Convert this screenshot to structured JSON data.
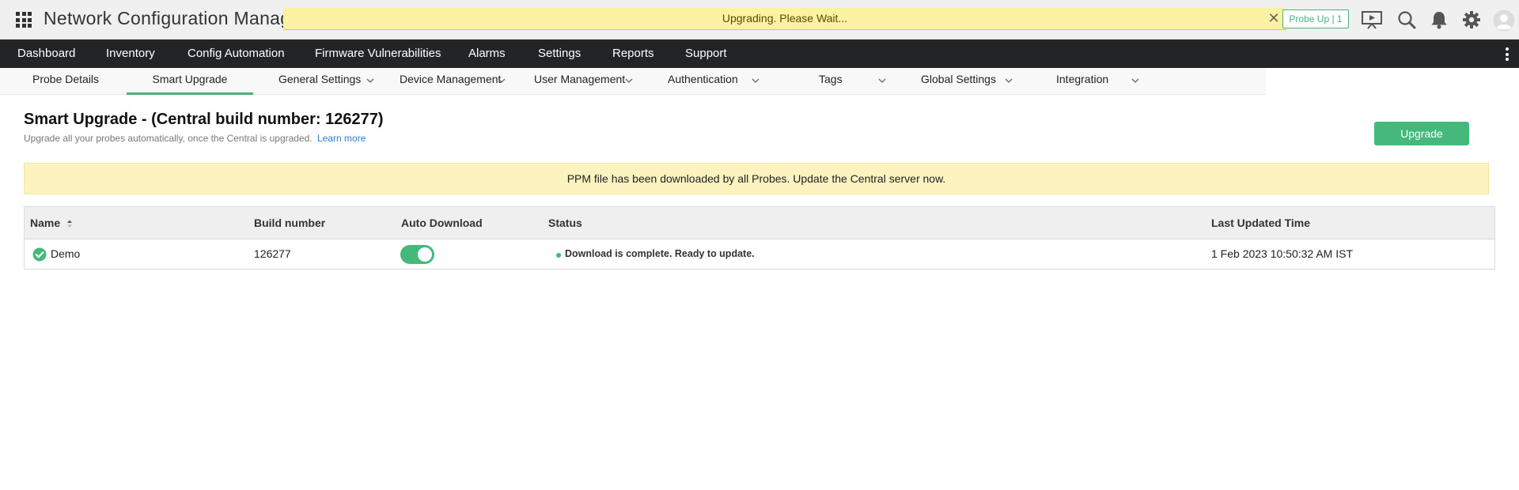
{
  "header": {
    "app_title": "Network Configuration Manager",
    "banner_text": "Upgrading. Please Wait...",
    "probe_badge": "Probe Up | 1"
  },
  "main_nav": [
    {
      "label": "Dashboard"
    },
    {
      "label": "Inventory"
    },
    {
      "label": "Config Automation"
    },
    {
      "label": "Firmware Vulnerabilities"
    },
    {
      "label": "Alarms"
    },
    {
      "label": "Settings"
    },
    {
      "label": "Reports"
    },
    {
      "label": "Support"
    }
  ],
  "sub_nav": [
    {
      "label": "Probe Details"
    },
    {
      "label": "Smart Upgrade",
      "active": true
    },
    {
      "label": "General Settings"
    },
    {
      "label": "Device Management"
    },
    {
      "label": "User Management"
    },
    {
      "label": "Authentication"
    },
    {
      "label": "Tags"
    },
    {
      "label": "Global Settings"
    },
    {
      "label": "Integration"
    }
  ],
  "page": {
    "title": "Smart Upgrade - (Central build number: 126277)",
    "subtitle": "Upgrade all your probes automatically, once the Central is upgraded.",
    "learn_more": "Learn more",
    "upgrade_button": "Upgrade",
    "info_message": "PPM file has been downloaded by all Probes. Update the Central server now."
  },
  "table": {
    "columns": [
      "Name",
      "Build number",
      "Auto Download",
      "Status",
      "Last Updated Time"
    ],
    "rows": [
      {
        "name": "Demo",
        "build_number": "126277",
        "auto_download": true,
        "status": "Download is complete. Ready to update.",
        "last_updated": "1 Feb 2023 10:50:32 AM IST"
      }
    ]
  },
  "colors": {
    "accent_green": "#45b97b",
    "banner_yellow": "#fbf2a3",
    "nav_dark": "#222426"
  }
}
